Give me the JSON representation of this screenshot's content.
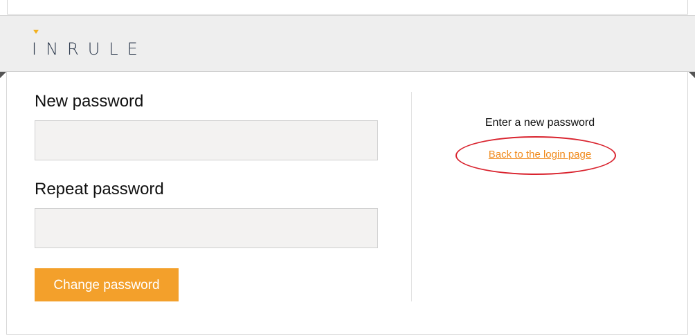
{
  "brand": {
    "logo_text": "INRULE",
    "accent_color": "#f2b01e"
  },
  "form": {
    "new_password_label": "New password",
    "new_password_value": "",
    "repeat_password_label": "Repeat password",
    "repeat_password_value": "",
    "submit_label": "Change password",
    "submit_color": "#f3a02b"
  },
  "sidebar": {
    "hint_text": "Enter a new password",
    "back_link_text": "Back to the login page",
    "link_color": "#f08a1c"
  },
  "annotation": {
    "highlight_color": "#d9232e"
  }
}
